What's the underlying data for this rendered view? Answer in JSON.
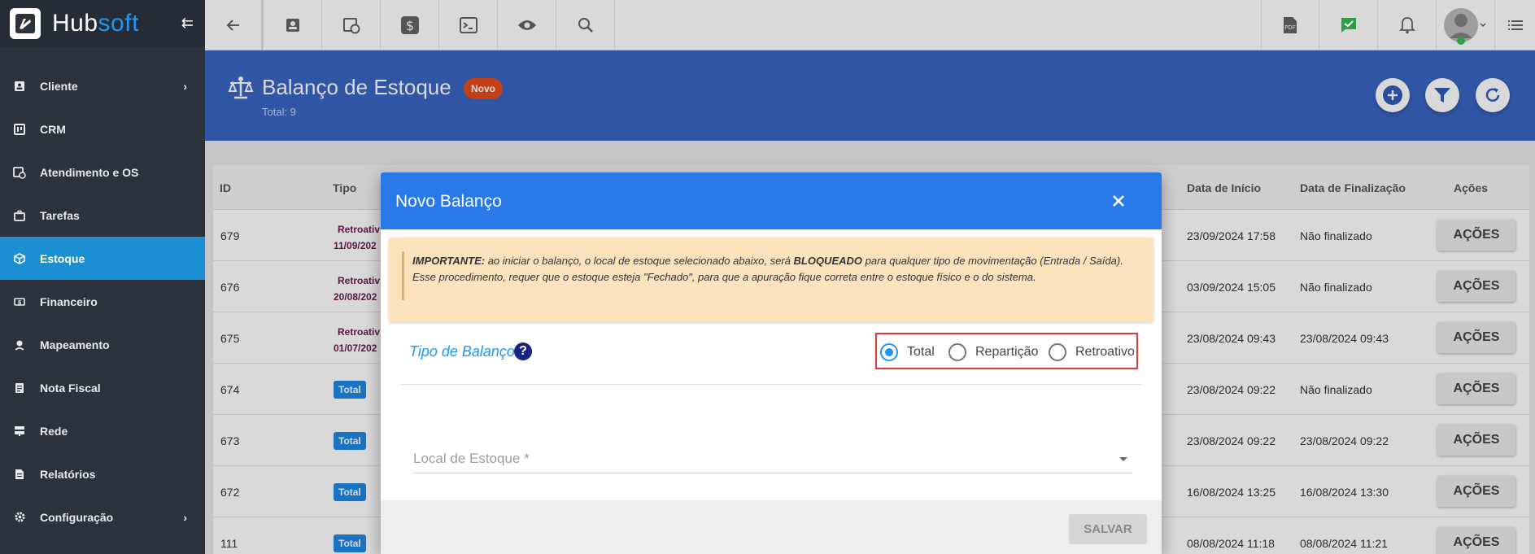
{
  "brand": {
    "name_part1": "Hub",
    "name_part2": "soft",
    "accent": "#2196f3"
  },
  "sidebar": {
    "items": [
      {
        "label": "Cliente",
        "icon": "contact-card-icon",
        "has_submenu": true
      },
      {
        "label": "CRM",
        "icon": "kanban-board-icon",
        "has_submenu": false
      },
      {
        "label": "Atendimento e OS",
        "icon": "calendar-clock-icon",
        "has_submenu": false
      },
      {
        "label": "Tarefas",
        "icon": "briefcase-icon",
        "has_submenu": false
      },
      {
        "label": "Estoque",
        "icon": "box-icon",
        "has_submenu": false,
        "active": true
      },
      {
        "label": "Financeiro",
        "icon": "money-icon",
        "has_submenu": false
      },
      {
        "label": "Mapeamento",
        "icon": "map-pin-icon",
        "has_submenu": false
      },
      {
        "label": "Nota Fiscal",
        "icon": "document-icon",
        "has_submenu": false
      },
      {
        "label": "Rede",
        "icon": "server-icon",
        "has_submenu": false
      },
      {
        "label": "Relatórios",
        "icon": "report-icon",
        "has_submenu": false
      },
      {
        "label": "Configuração",
        "icon": "gear-icon",
        "has_submenu": true
      }
    ]
  },
  "topbar": {
    "left_icons": [
      "back-arrow-icon",
      "contact-card-icon",
      "calendar-clock-icon",
      "dollar-icon",
      "terminal-icon",
      "eye-icon",
      "search-icon"
    ],
    "right_icons": [
      "pdf-file-icon",
      "message-check-icon",
      "bell-icon",
      "user-avatar-icon",
      "list-menu-icon"
    ]
  },
  "page": {
    "title": "Balanço de Estoque",
    "badge": "Novo",
    "total": "Total: 9"
  },
  "table": {
    "columns": {
      "id": "ID",
      "tipo": "Tipo",
      "inicio": "Data de Início",
      "fim": "Data de Finalização",
      "acoes": "Ações"
    },
    "rows": [
      {
        "id": "679",
        "tipo": "Retroativ",
        "tipo_date": "11/09/202",
        "inicio": "23/09/2024 17:58",
        "fim": "Não finalizado",
        "acao": "AÇÕES"
      },
      {
        "id": "676",
        "tipo": "Retroativ",
        "tipo_date": "20/08/202",
        "inicio": "03/09/2024 15:05",
        "fim": "Não finalizado",
        "acao": "AÇÕES"
      },
      {
        "id": "675",
        "tipo": "Retroativ",
        "tipo_date": "01/07/202",
        "inicio": "23/08/2024 09:43",
        "fim": "23/08/2024 09:43",
        "acao": "AÇÕES"
      },
      {
        "id": "674",
        "tipo": "Total",
        "tipo_date": "",
        "inicio": "23/08/2024 09:22",
        "fim": "Não finalizado",
        "acao": "AÇÕES"
      },
      {
        "id": "673",
        "tipo": "Total",
        "tipo_date": "",
        "inicio": "23/08/2024 09:22",
        "fim": "23/08/2024 09:22",
        "acao": "AÇÕES"
      },
      {
        "id": "672",
        "tipo": "Total",
        "tipo_date": "",
        "inicio": "16/08/2024 13:25",
        "fim": "16/08/2024 13:30",
        "acao": "AÇÕES"
      },
      {
        "id": "111",
        "tipo": "Total",
        "tipo_date": "",
        "inicio": "08/08/2024 11:18",
        "fim": "08/08/2024 11:21",
        "acao": "AÇÕES"
      }
    ]
  },
  "modal": {
    "title": "Novo Balanço",
    "notice": {
      "lead": "IMPORTANTE:",
      "text1": " ao iniciar o balanço, o local de estoque selecionado abaixo, será ",
      "bold": "BLOQUEADO",
      "text2": " para qualquer tipo de movimentação (Entrada / Saída). Esse procedimento, requer que o estoque esteja \"Fechado\", para que a apuração fique correta entre o estoque físico e o do sistema."
    },
    "tipo_label": "Tipo de Balanço",
    "tipo_options": [
      "Total",
      "Repartição",
      "Retroativo"
    ],
    "tipo_selected": "Total",
    "local_label": "Local de Estoque *",
    "save_label": "SALVAR"
  }
}
